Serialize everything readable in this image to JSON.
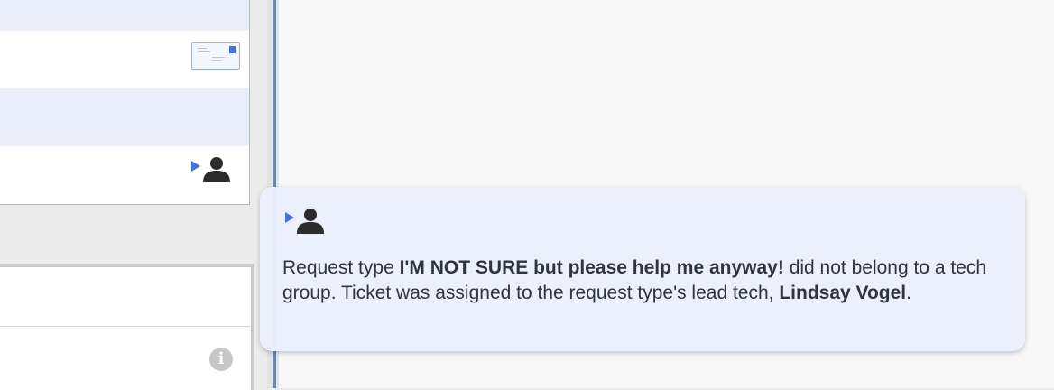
{
  "tooltip": {
    "text_prefix": "Request type ",
    "request_type": "I'M NOT SURE but please help me anyway!",
    "text_middle": " did not belong to a tech group. Ticket was assigned to the request type's lead tech, ",
    "tech_name": "Lindsay Vogel",
    "text_suffix": "."
  },
  "icons": {
    "email": "envelope-icon",
    "assigned": "assigned-tech-icon",
    "info": "info-icon",
    "info_glyph": "i"
  },
  "colors": {
    "row_alt": "#e8effb",
    "tooltip_bg": "#eaf0fd",
    "arrow": "#3f74e0",
    "person": "#2b2b2b"
  }
}
